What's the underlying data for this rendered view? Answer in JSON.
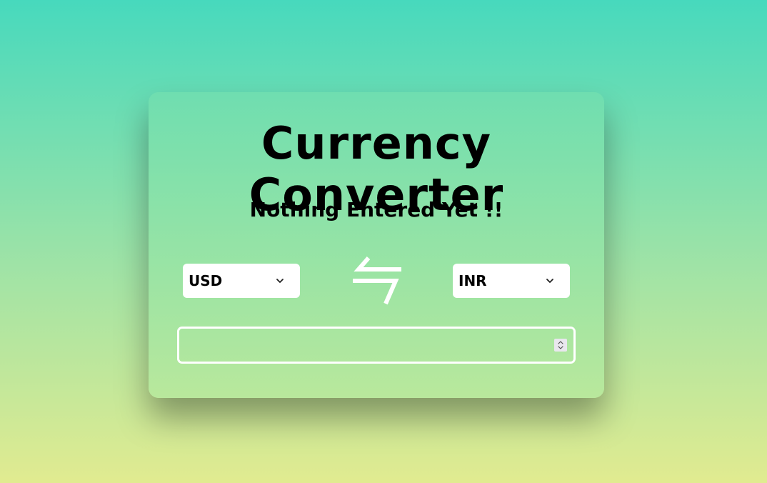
{
  "converter": {
    "title": "Currency Converter",
    "status": "Nothing Entered Yet !!",
    "from_currency": "USD",
    "to_currency": "INR",
    "amount_value": "",
    "swap_icon": "swap-arrows-icon",
    "chevron_icon": "chevron-down-icon"
  },
  "colors": {
    "background_top": "#47d9bd",
    "background_bottom": "#e1eb90",
    "card_top": "#6fdeb0",
    "card_bottom": "#b9e89c",
    "text": "#000000",
    "control_bg": "#ffffff"
  }
}
